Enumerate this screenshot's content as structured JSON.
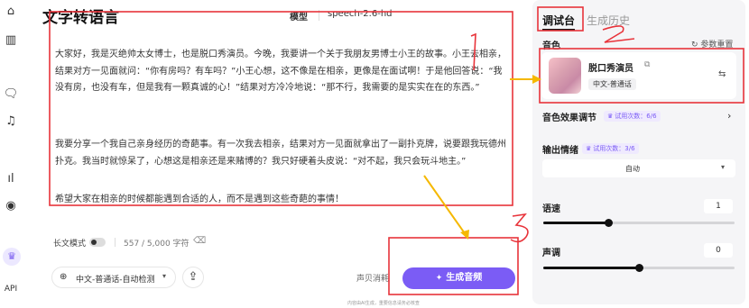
{
  "header": {
    "title": "文字转语言",
    "model_label": "模型",
    "model_value": "speech-2.6-hd"
  },
  "rail": {
    "icons": [
      "home-icon",
      "bars-icon",
      "speech-icon",
      "music-icon",
      "waveform-icon",
      "broadcast-icon"
    ],
    "api_label": "API"
  },
  "editor": {
    "paragraph1": "大家好，我是灭绝帅太女博士，也是脱口秀演员。今晚，我要讲一个关于我朋友男博士小王的故事。小王去相亲，结果对方一见面就问：“你有房吗？有车吗？”小王心想，这不像是在相亲，更像是在面试啊！于是他回答说：“我没有房，也没有车，但是我有一颗真诚的心！”结果对方冷冷地说：“那不行，我需要的是实实在在的东西。”",
    "paragraph2": "我要分享一个我自己亲身经历的奇葩事。有一次我去相亲，结果对方一见面就拿出了一副扑克牌，说要跟我玩德州扑克。我当时就惊呆了，心想这是相亲还是来赌博的？我只好硬着头皮说：“对不起，我只会玩斗地主。”",
    "paragraph3": "希望大家在相亲的时候都能遇到合适的人，而不是遇到这些奇葩的事情！",
    "long_mode_label": "长文模式",
    "char_count": "557 / 5,000 字符",
    "language": "中文-普通话-自动检测",
    "shell_label": "声贝消耗",
    "generate_label": "生成音频",
    "disclaimer": "内容由AI生成，重要信息请务必核查"
  },
  "panel": {
    "tabs": [
      "调试台",
      "生成历史"
    ],
    "voice_section": "音色",
    "reset_label": "参数重置",
    "voice_name": "脱口秀演员",
    "voice_tag": "中文-普通话",
    "effect_section": "音色效果调节",
    "effect_trial": "试用次数：6/6",
    "emotion_section": "输出情绪",
    "emotion_trial": "试用次数：3/6",
    "emotion_value": "自动",
    "speed_label": "语速",
    "speed_value": "1",
    "pitch_label": "声调",
    "pitch_value": "0",
    "speed_level": 0.34,
    "pitch_level": 0.5
  },
  "annotations": {
    "labels": [
      "1",
      "2",
      "3"
    ],
    "color": "#e8333a",
    "arrow_color": "#f5b800"
  }
}
